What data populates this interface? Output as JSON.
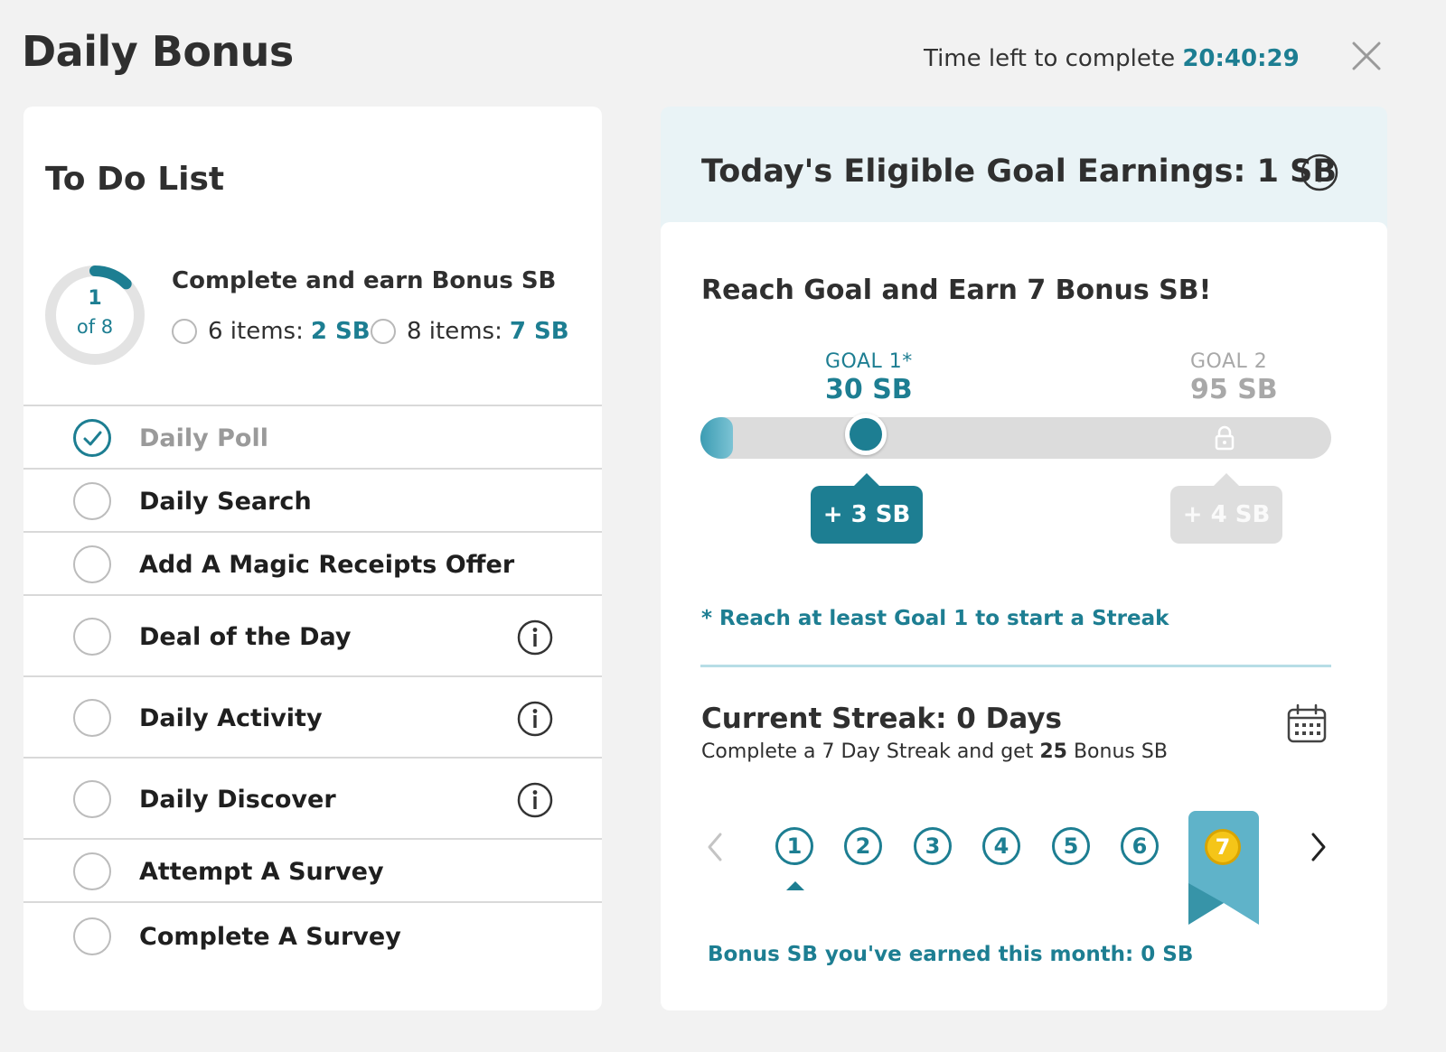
{
  "header": {
    "title": "Daily Bonus",
    "timer_label": "Time left to complete",
    "timer_value": "20:40:29"
  },
  "todo": {
    "title": "To Do List",
    "progress": {
      "completed": 1,
      "total": 8,
      "count_text": "1",
      "of_text": "of 8"
    },
    "earn_heading": "Complete and earn Bonus SB",
    "options": [
      {
        "items_text": "6 items:",
        "sb_text": "2 SB"
      },
      {
        "items_text": "8 items:",
        "sb_text": "7 SB"
      }
    ],
    "tasks": [
      {
        "label": "Daily Poll",
        "done": true,
        "info": false
      },
      {
        "label": "Daily Search",
        "done": false,
        "info": false
      },
      {
        "label": "Add A Magic Receipts Offer",
        "done": false,
        "info": false
      },
      {
        "label": "Deal of the Day",
        "done": false,
        "info": true
      },
      {
        "label": "Daily Activity",
        "done": false,
        "info": true
      },
      {
        "label": "Daily Discover",
        "done": false,
        "info": true
      },
      {
        "label": "Attempt A Survey",
        "done": false,
        "info": false
      },
      {
        "label": "Complete A Survey",
        "done": false,
        "info": false
      }
    ]
  },
  "goals": {
    "eligible_earnings": "Today's Eligible Goal Earnings: 1 SB",
    "reach_heading": "Reach Goal and Earn 7 Bonus SB!",
    "goal1": {
      "label": "GOAL 1*",
      "value": "30 SB",
      "bonus": "+ 3 SB"
    },
    "goal2": {
      "label": "GOAL 2",
      "value": "95 SB",
      "bonus": "+ 4 SB"
    },
    "streak_note": "* Reach at least Goal 1 to start a Streak"
  },
  "streak": {
    "title": "Current Streak: 0 Days",
    "sub_prefix": "Complete a 7 Day Streak and get",
    "sub_amount": "25",
    "sub_suffix": "Bonus SB",
    "days": [
      "1",
      "2",
      "3",
      "4",
      "5",
      "6",
      "7"
    ],
    "month_earned": "Bonus SB you've earned this month:  0 SB"
  },
  "colors": {
    "accent": "#1d7e92",
    "background": "#f2f2f2",
    "header_tint": "#e9f3f6",
    "gold": "#f5c518",
    "ribbon": "#5fb3c9"
  }
}
